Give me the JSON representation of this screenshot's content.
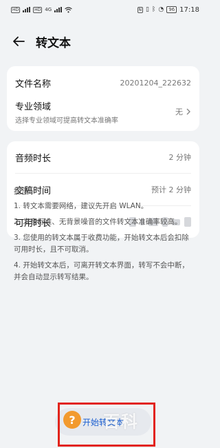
{
  "status_bar": {
    "network": "4G",
    "battery": "96",
    "time": "17:18"
  },
  "header": {
    "title": "转文本"
  },
  "file_card": {
    "filename_label": "文件名称",
    "filename_value": "20201204_222632",
    "domain_label": "专业领域",
    "domain_sub": "选择专业领域可提高转文本准确率",
    "domain_value": "无"
  },
  "duration_card": {
    "audio_label": "音频时长",
    "audio_value": "2 分钟",
    "handover_label": "交稿时间",
    "handover_value": "预计 2 分钟",
    "available_label": "可用时长"
  },
  "tips": {
    "title": "提示",
    "items": [
      "1. 转文本需要网络，建议先开启 WLAN。",
      "2. 发音标准、无背景噪音的文件转文本准确率较高。",
      "3. 您使用的转文本属于收费功能，开始转文本后会扣除可用时长，且不可取消。",
      "4. 开始转文本后，可离开转文本界面，转写不会中断，并会自动显示转写结果。"
    ]
  },
  "start_button": {
    "label": "开始转文本"
  },
  "watermark": {
    "text": "百科"
  },
  "colors": {
    "accent": "#1b5fd1",
    "highlight": "#e2231a",
    "background": "#f1f3f5"
  }
}
